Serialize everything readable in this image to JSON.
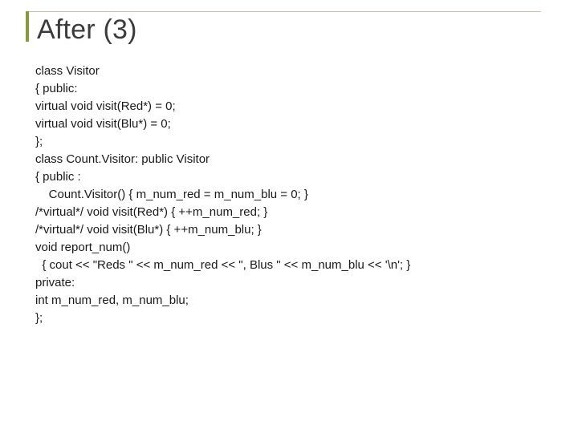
{
  "slide": {
    "title": "After (3)",
    "code_lines": [
      "class Visitor",
      "{ public:",
      "virtual void visit(Red*) = 0;",
      "virtual void visit(Blu*) = 0;",
      "};",
      "class Count.Visitor: public Visitor",
      "{ public :",
      "    Count.Visitor() { m_num_red = m_num_blu = 0; }",
      "/*virtual*/ void visit(Red*) { ++m_num_red; }",
      "/*virtual*/ void visit(Blu*) { ++m_num_blu; }",
      "void report_num()",
      "  { cout << \"Reds \" << m_num_red << \", Blus \" << m_num_blu << '\\n'; }",
      "private:",
      "int m_num_red, m_num_blu;",
      "};"
    ]
  }
}
